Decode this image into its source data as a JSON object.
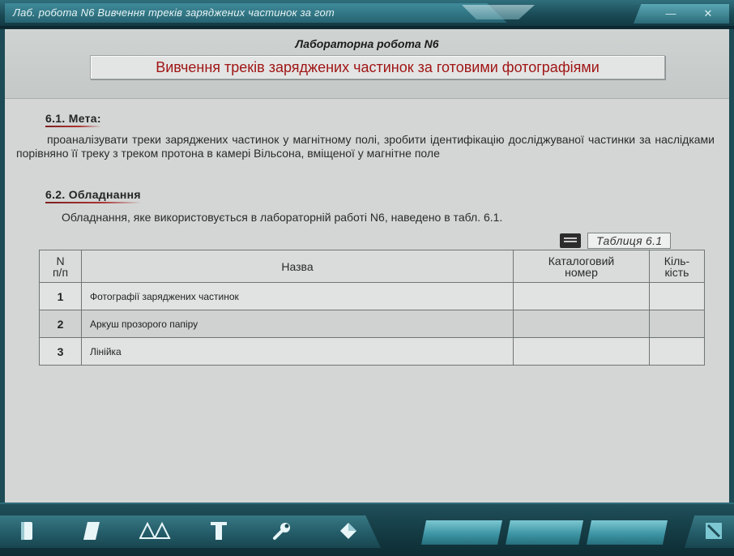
{
  "window": {
    "title": "Лаб. робота N6   Вивчення треків заряджених частинок за гот",
    "minimize_glyph": "—",
    "close_glyph": "✕"
  },
  "header": {
    "lab_title": "Лабораторна робота N6",
    "subtitle": "Вивчення треків заряджених частинок за готовими фотографіями"
  },
  "goal": {
    "heading": "6.1. Мета:",
    "text": "проаналізувати треки заряджених частинок у магнітному полі, зробити ідентифікацію досліджуваної частинки за наслідками порівняно її треку з треком протона в камері Вільсона, вміщеної у магнітне поле"
  },
  "equipment": {
    "heading": "6.2. Обладнання",
    "intro": "Обладнання, яке використовується в лабораторній работі N6, наведено в табл. 6.1.",
    "table_label": "Таблиця 6.1",
    "columns": {
      "num": "N\nп/п",
      "name": "Назва",
      "catalog": "Каталоговий\nномер",
      "qty": "Кіль-\nкість"
    },
    "rows": [
      {
        "num": "1",
        "name": "Фотографії заряджених частинок",
        "catalog": "",
        "qty": ""
      },
      {
        "num": "2",
        "name": "Аркуш прозорого папіру",
        "catalog": "",
        "qty": ""
      },
      {
        "num": "3",
        "name": "Лінійка",
        "catalog": "",
        "qty": ""
      }
    ]
  },
  "toolbar": {
    "icons": [
      "document-icon",
      "book-icon",
      "triangles-icon",
      "pillar-icon",
      "wrench-icon",
      "diamond-icon",
      "nav-prev",
      "nav-center",
      "nav-next",
      "expand-icon"
    ]
  }
}
